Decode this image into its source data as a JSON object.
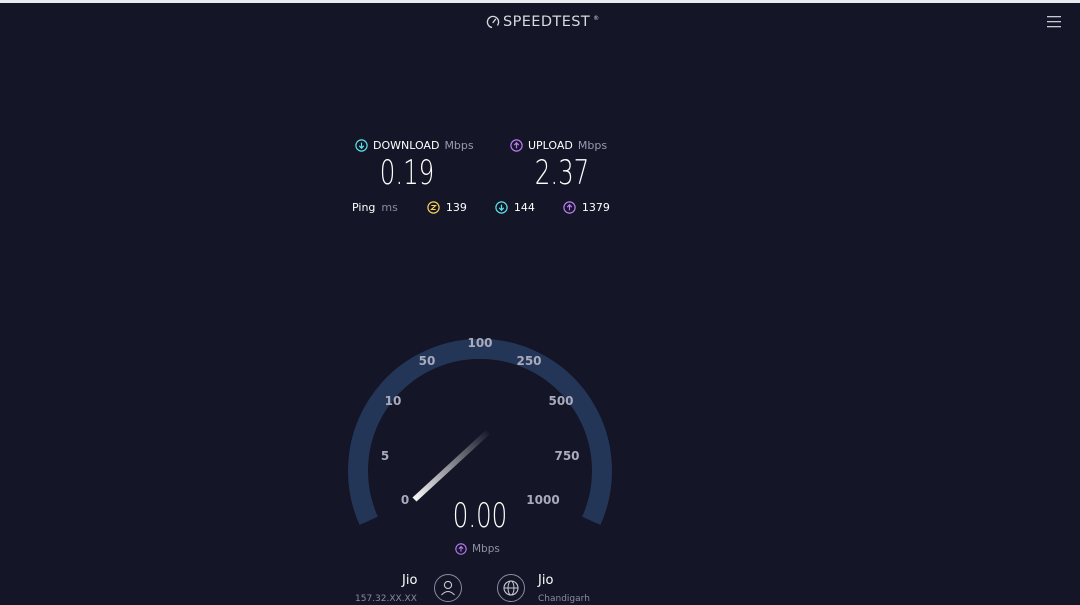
{
  "app": {
    "logo_text": "SPEEDTEST",
    "logo_mark": "®",
    "menu_icon": "hamburger-menu-icon"
  },
  "results": {
    "download": {
      "label": "DOWNLOAD",
      "unit": "Mbps",
      "value": "0.19",
      "icon": "download-arrow-icon",
      "color": "#5ce1e6"
    },
    "upload": {
      "label": "UPLOAD",
      "unit": "Mbps",
      "value": "2.37",
      "icon": "upload-arrow-icon",
      "color": "#b97cf0"
    }
  },
  "ping": {
    "label": "Ping",
    "unit": "ms",
    "idle": {
      "value": "139",
      "icon": "idle-latency-icon",
      "color": "#f3d25c"
    },
    "download": {
      "value": "144",
      "icon": "download-latency-icon",
      "color": "#5ce1e6"
    },
    "upload": {
      "value": "1379",
      "icon": "upload-latency-icon",
      "color": "#b97cf0"
    }
  },
  "gauge": {
    "ticks": [
      "0",
      "5",
      "10",
      "50",
      "100",
      "250",
      "500",
      "750",
      "1000"
    ],
    "current_value": "0.00",
    "unit": "Mbps",
    "unit_icon": "upload-arrow-icon",
    "track_color": "#243658"
  },
  "connection": {
    "isp_name": "Jio",
    "isp_id": "157.32.XX.XX",
    "server_name": "Jio",
    "server_location": "Chandigarh"
  }
}
